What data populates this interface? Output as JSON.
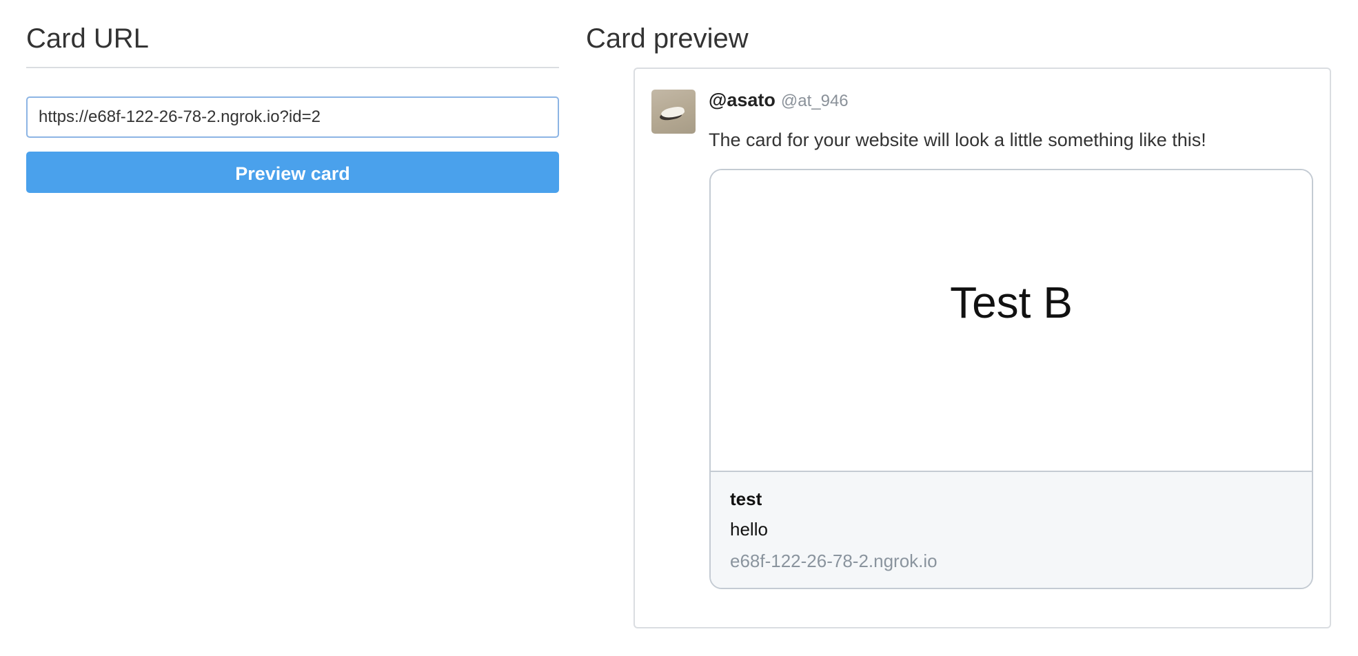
{
  "left": {
    "title": "Card URL",
    "url_input": {
      "value": "https://e68f-122-26-78-2.ngrok.io?id=2",
      "placeholder": ""
    },
    "preview_button_label": "Preview card"
  },
  "right": {
    "title": "Card preview",
    "tweet": {
      "display_name": "@asato",
      "handle": "@at_946",
      "text": "The card for your website will look a little something like this!",
      "avatar_icon": "avatar-photo-icon",
      "card": {
        "image_text": "Test B",
        "title": "test",
        "description": "hello",
        "domain": "e68f-122-26-78-2.ngrok.io"
      }
    }
  },
  "colors": {
    "button_bg": "#4aa1ec",
    "input_border": "#8cb4e4",
    "card_footer_bg": "#f5f7f9",
    "domain_text": "#8a949e",
    "handle_text": "#8a9199"
  }
}
